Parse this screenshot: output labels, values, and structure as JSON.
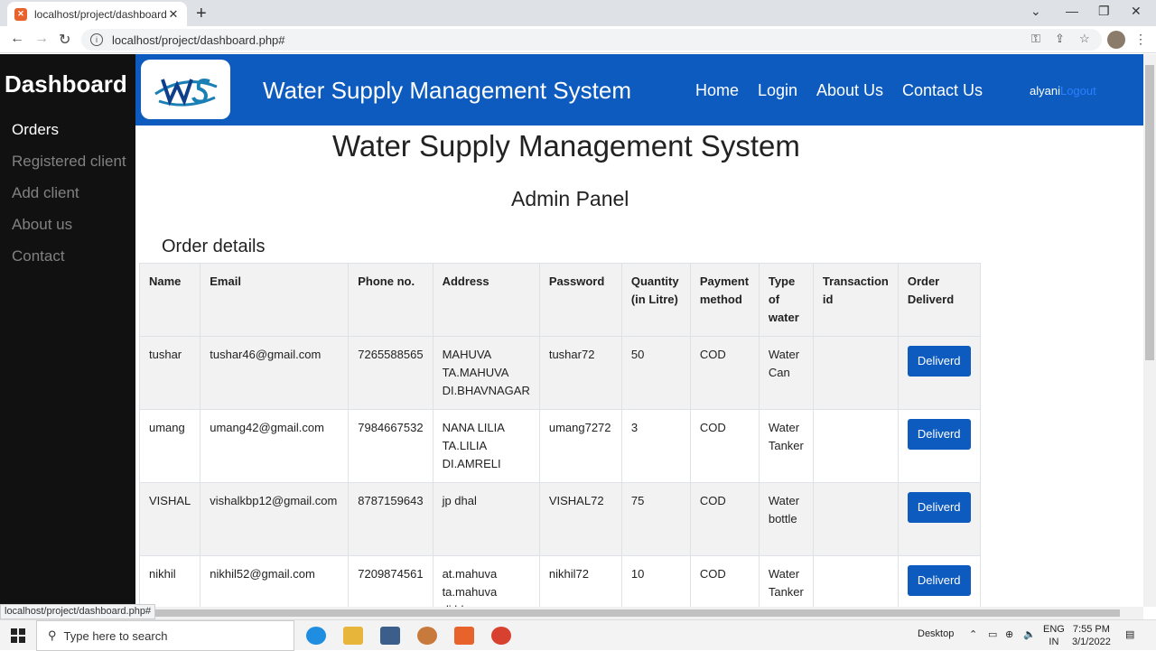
{
  "browser": {
    "tab_title": "localhost/project/dashboard.php",
    "url": "localhost/project/dashboard.php#",
    "status_url": "localhost/project/dashboard.php#"
  },
  "sidebar": {
    "brand": "Dashboard",
    "items": [
      {
        "label": "Orders"
      },
      {
        "label": "Registered client"
      },
      {
        "label": "Add client"
      },
      {
        "label": "About us"
      },
      {
        "label": "Contact"
      }
    ]
  },
  "header": {
    "title": "Water Supply Management System",
    "nav": [
      "Home",
      "Login",
      "About Us",
      "Contact Us"
    ],
    "username": "alyani",
    "logout": "Logout"
  },
  "main": {
    "title": "Water Supply Management System",
    "subtitle": "Admin Panel",
    "section": "Order details"
  },
  "table": {
    "headers": [
      "Name",
      "Email",
      "Phone no.",
      "Address",
      "Password",
      "Quantity (in Litre)",
      "Payment method",
      "Type of water",
      "Transaction id",
      "Order Deliverd"
    ],
    "rows": [
      [
        "tushar",
        "tushar46@gmail.com",
        "7265588565",
        "MAHUVA TA.MAHUVA DI.BHAVNAGAR",
        "tushar72",
        "50",
        "COD",
        "Water Can",
        ""
      ],
      [
        "umang",
        "umang42@gmail.com",
        "7984667532",
        "NANA LILIA TA.LILIA DI.AMRELI",
        "umang7272",
        "3",
        "COD",
        "Water Tanker",
        ""
      ],
      [
        "VISHAL",
        "vishalkbp12@gmail.com",
        "8787159643",
        "jp dhal",
        "VISHAL72",
        "75",
        "COD",
        "Water bottle",
        ""
      ],
      [
        "nikhil",
        "nikhil52@gmail.com",
        "7209874561",
        "at.mahuva ta.mahuva di.bhavnagar",
        "nikhil72",
        "10",
        "COD",
        "Water Tanker",
        ""
      ]
    ],
    "button_label": "Deliverd"
  },
  "taskbar": {
    "search_placeholder": "Type here to search",
    "desktop": "Desktop",
    "lang": "ENG",
    "region": "IN",
    "time": "7:55 PM",
    "date": "3/1/2022"
  }
}
